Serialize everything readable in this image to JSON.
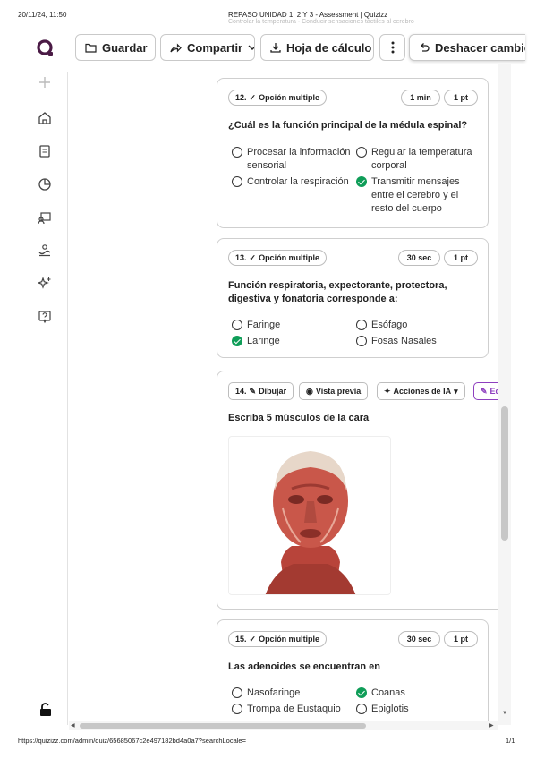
{
  "print": {
    "date": "20/11/24, 11:50",
    "title": "REPASO UNIDAD 1, 2 Y 3 - Assessment | Quizizz",
    "ghost_text": "Controlar la temperatura · Conducir sensaciones táctiles al cerebro",
    "url": "https://quizizz.com/admin/quiz/65685067c2e497182bd4a0a7?searchLocale=",
    "page": "1/1"
  },
  "toolbar": {
    "save_label": "Guardar",
    "share_label": "Compartir",
    "sheet_label": "Hoja de cálculo",
    "undo_label": "Deshacer cambios"
  },
  "brand": {
    "accent": "#4a1a45",
    "success": "#0f9d58",
    "edit_accent": "#8e3fbf"
  },
  "sidebar": {
    "icons": [
      "plus-icon",
      "home-icon",
      "library-icon",
      "reports-icon",
      "classes-icon",
      "accommodations-icon",
      "ai-sparkle-icon",
      "help-icon",
      "lock-icon"
    ]
  },
  "questions": [
    {
      "number_label": "12.",
      "type_label": "Opción multiple",
      "time": "1 min",
      "points": "1 pt",
      "text": "¿Cuál es la función principal de la médula espinal?",
      "options": [
        {
          "text": "Procesar la información sensorial",
          "correct": false
        },
        {
          "text": "Regular la temperatura corporal",
          "correct": false
        },
        {
          "text": "Controlar la respiración",
          "correct": false
        },
        {
          "text": "Transmitir mensajes entre el cerebro y el resto del cuerpo",
          "correct": true
        }
      ]
    },
    {
      "number_label": "13.",
      "type_label": "Opción multiple",
      "time": "30 sec",
      "points": "1 pt",
      "text": "Función respiratoria, expectorante, protectora, digestiva y fonatoria corresponde a:",
      "options": [
        {
          "text": "Faringe",
          "correct": false
        },
        {
          "text": "Esófago",
          "correct": false
        },
        {
          "text": "Laringe",
          "correct": true
        },
        {
          "text": "Fosas Nasales",
          "correct": false
        }
      ]
    },
    {
      "number_label": "14.",
      "type_label": "Dibujar",
      "preview_label": "Vista previa",
      "ai_label": "Acciones de IA",
      "edit_label": "Ed",
      "text": "Escriba 5 músculos de la cara"
    },
    {
      "number_label": "15.",
      "type_label": "Opción multiple",
      "time": "30 sec",
      "points": "1 pt",
      "text": "Las adenoides se encuentran en",
      "options": [
        {
          "text": "Nasofaringe",
          "correct": false
        },
        {
          "text": "Coanas",
          "correct": true
        },
        {
          "text": "Trompa de Eustaquio",
          "correct": false
        },
        {
          "text": "Epiglotis",
          "correct": false
        }
      ]
    }
  ]
}
